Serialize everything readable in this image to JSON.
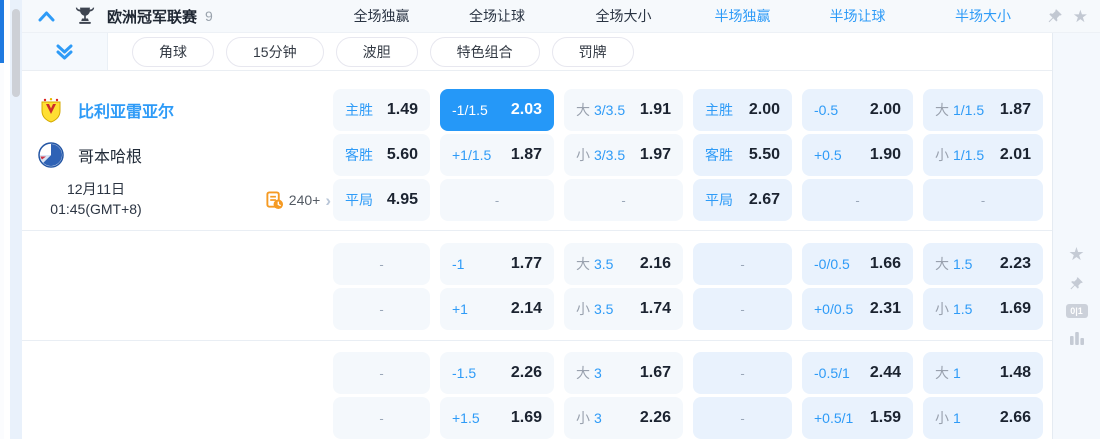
{
  "colors": {
    "accent": "#2e9bf7",
    "highlight_cell": "#2598f8",
    "text_dark": "#1d2633",
    "gray_label": "#99a1ae",
    "cell_fulltime_bg": "#f4f8fc",
    "cell_halftime_bg": "#e9f2fd",
    "orange": "#f59a23"
  },
  "icons": {
    "star": "★",
    "chevron_right": "›"
  },
  "header": {
    "league_title": "欧洲冠军联赛",
    "match_count": "9",
    "columns": [
      {
        "label": "全场独赢",
        "half": false
      },
      {
        "label": "全场让球",
        "half": false
      },
      {
        "label": "全场大小",
        "half": false
      },
      {
        "label": "半场独赢",
        "half": true
      },
      {
        "label": "半场让球",
        "half": true
      },
      {
        "label": "半场大小",
        "half": true
      }
    ]
  },
  "tabs": [
    "角球",
    "15分钟",
    "波胆",
    "特色组合",
    "罚牌"
  ],
  "match": {
    "home_team": "比利亚雷亚尔",
    "away_team": "哥本哈根",
    "date": "12月11日",
    "time": "01:45(GMT+8)",
    "more_markets": "240+"
  },
  "rail": {
    "badge": "0|1"
  },
  "odds": {
    "sections": [
      {
        "rows": [
          [
            {
              "line": "主胜",
              "value": "1.49"
            },
            {
              "line": "-1/1.5",
              "value": "2.03",
              "highlight": true
            },
            {
              "prefix": "大",
              "line": "3/3.5",
              "value": "1.91"
            },
            {
              "line": "主胜",
              "value": "2.00"
            },
            {
              "line": "-0.5",
              "value": "2.00"
            },
            {
              "prefix": "大",
              "line": "1/1.5",
              "value": "1.87"
            }
          ],
          [
            {
              "line": "客胜",
              "value": "5.60"
            },
            {
              "line": "+1/1.5",
              "value": "1.87"
            },
            {
              "prefix": "小",
              "line": "3/3.5",
              "value": "1.97"
            },
            {
              "line": "客胜",
              "value": "5.50"
            },
            {
              "line": "+0.5",
              "value": "1.90"
            },
            {
              "prefix": "小",
              "line": "1/1.5",
              "value": "2.01"
            }
          ],
          [
            {
              "line": "平局",
              "value": "4.95"
            },
            {
              "dash": "-"
            },
            {
              "dash": "-"
            },
            {
              "line": "平局",
              "value": "2.67"
            },
            {
              "dash": "-"
            },
            {
              "dash": "-"
            }
          ]
        ]
      },
      {
        "rows": [
          [
            {
              "dash": "-"
            },
            {
              "line": "-1",
              "value": "1.77"
            },
            {
              "prefix": "大",
              "line": "3.5",
              "value": "2.16"
            },
            {
              "dash": "-"
            },
            {
              "line": "-0/0.5",
              "value": "1.66"
            },
            {
              "prefix": "大",
              "line": "1.5",
              "value": "2.23"
            }
          ],
          [
            {
              "dash": "-"
            },
            {
              "line": "+1",
              "value": "2.14"
            },
            {
              "prefix": "小",
              "line": "3.5",
              "value": "1.74"
            },
            {
              "dash": "-"
            },
            {
              "line": "+0/0.5",
              "value": "2.31"
            },
            {
              "prefix": "小",
              "line": "1.5",
              "value": "1.69"
            }
          ]
        ]
      },
      {
        "rows": [
          [
            {
              "dash": "-"
            },
            {
              "line": "-1.5",
              "value": "2.26"
            },
            {
              "prefix": "大",
              "line": "3",
              "value": "1.67"
            },
            {
              "dash": "-"
            },
            {
              "line": "-0.5/1",
              "value": "2.44"
            },
            {
              "prefix": "大",
              "line": "1",
              "value": "1.48"
            }
          ],
          [
            {
              "dash": "-"
            },
            {
              "line": "+1.5",
              "value": "1.69"
            },
            {
              "prefix": "小",
              "line": "3",
              "value": "2.26"
            },
            {
              "dash": "-"
            },
            {
              "line": "+0.5/1",
              "value": "1.59"
            },
            {
              "prefix": "小",
              "line": "1",
              "value": "2.66"
            }
          ]
        ]
      }
    ]
  }
}
